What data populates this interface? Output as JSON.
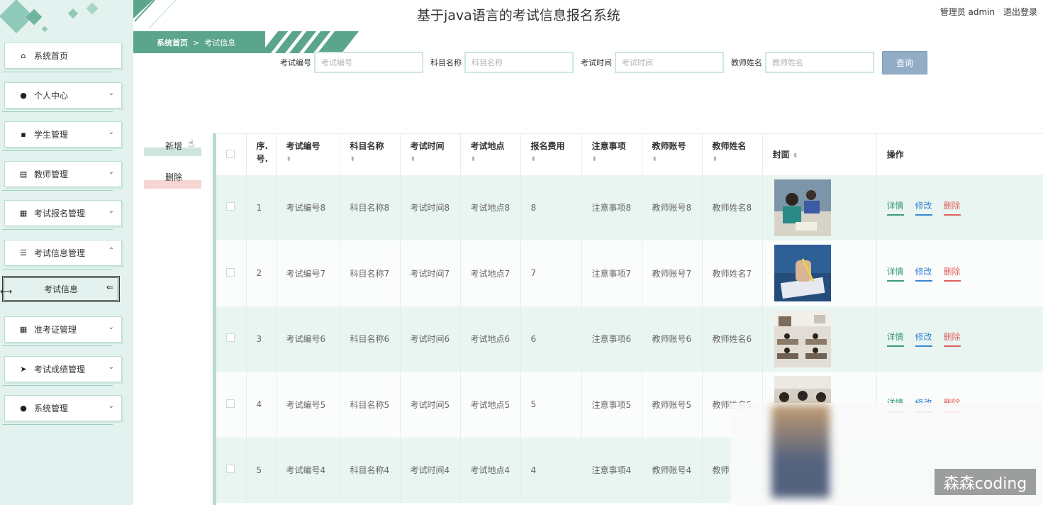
{
  "header": {
    "title": "基于java语言的考试信息报名系统",
    "user": "管理员 admin",
    "logout": "退出登录"
  },
  "breadcrumb": {
    "home": "系统首页",
    "sep": ">",
    "current": "考试信息"
  },
  "sidebar": {
    "items": [
      {
        "label": "系统首页",
        "icon": "home-icon",
        "glyph": "⌂",
        "arrow": ""
      },
      {
        "label": "个人中心",
        "icon": "user-icon",
        "glyph": "●",
        "arrow": "⌄"
      },
      {
        "label": "学生管理",
        "icon": "ticket-icon",
        "glyph": "▪",
        "arrow": "⌄"
      },
      {
        "label": "教师管理",
        "icon": "clipboard-icon",
        "glyph": "▤",
        "arrow": "⌄"
      },
      {
        "label": "考试报名管理",
        "icon": "grid-icon",
        "glyph": "▦",
        "arrow": "⌄"
      },
      {
        "label": "考试信息管理",
        "icon": "list-icon",
        "glyph": "☰",
        "arrow": "⌃"
      }
    ],
    "sub_item": "考试信息",
    "items_after": [
      {
        "label": "准考证管理",
        "icon": "grid-icon",
        "glyph": "▦",
        "arrow": "⌄"
      },
      {
        "label": "考试成绩管理",
        "icon": "send-icon",
        "glyph": "➤",
        "arrow": "⌄"
      },
      {
        "label": "系统管理",
        "icon": "pin-icon",
        "glyph": "●",
        "arrow": "⌄"
      }
    ]
  },
  "search": {
    "fields": [
      {
        "label": "考试编号",
        "placeholder": "考试编号"
      },
      {
        "label": "科目名称",
        "placeholder": "科目名称"
      },
      {
        "label": "考试时间",
        "placeholder": "考试时间"
      },
      {
        "label": "教师姓名",
        "placeholder": "教师姓名"
      }
    ],
    "button": "查询"
  },
  "actions": {
    "add": "新增",
    "delete": "删除"
  },
  "table": {
    "columns": [
      "序.号.",
      "考试编号",
      "科目名称",
      "考试时间",
      "考试地点",
      "报名费用",
      "注意事项",
      "教师账号",
      "教师姓名",
      "封面",
      "操作"
    ],
    "ops": {
      "detail": "详情",
      "edit": "修改",
      "remove": "删除"
    },
    "rows": [
      {
        "no": "1",
        "exam_no": "考试编号8",
        "subject": "科目名称8",
        "time": "考试时间8",
        "place": "考试地点8",
        "fee": "8",
        "notes": "注意事项8",
        "teacher_acct": "教师账号8",
        "teacher_name": "教师姓名8"
      },
      {
        "no": "2",
        "exam_no": "考试编号7",
        "subject": "科目名称7",
        "time": "考试时间7",
        "place": "考试地点7",
        "fee": "7",
        "notes": "注意事项7",
        "teacher_acct": "教师账号7",
        "teacher_name": "教师姓名7"
      },
      {
        "no": "3",
        "exam_no": "考试编号6",
        "subject": "科目名称6",
        "time": "考试时间6",
        "place": "考试地点6",
        "fee": "6",
        "notes": "注意事项6",
        "teacher_acct": "教师账号6",
        "teacher_name": "教师姓名6"
      },
      {
        "no": "4",
        "exam_no": "考试编号5",
        "subject": "科目名称5",
        "time": "考试时间5",
        "place": "考试地点5",
        "fee": "5",
        "notes": "注意事项5",
        "teacher_acct": "教师账号5",
        "teacher_name": "教师姓名5"
      },
      {
        "no": "5",
        "exam_no": "考试编号4",
        "subject": "科目名称4",
        "time": "考试时间4",
        "place": "考试地点4",
        "fee": "4",
        "notes": "注意事项4",
        "teacher_acct": "教师账号4",
        "teacher_name": "教师"
      }
    ]
  },
  "watermark": "森森coding",
  "colors": {
    "accent": "#5aa58c",
    "sidebar_bg": "#e3f2ee",
    "row_tint": "#e9f5f1",
    "query_button": "#93adc7",
    "detail": "#3d9b7c",
    "edit": "#3a86d6",
    "remove": "#e06060"
  }
}
